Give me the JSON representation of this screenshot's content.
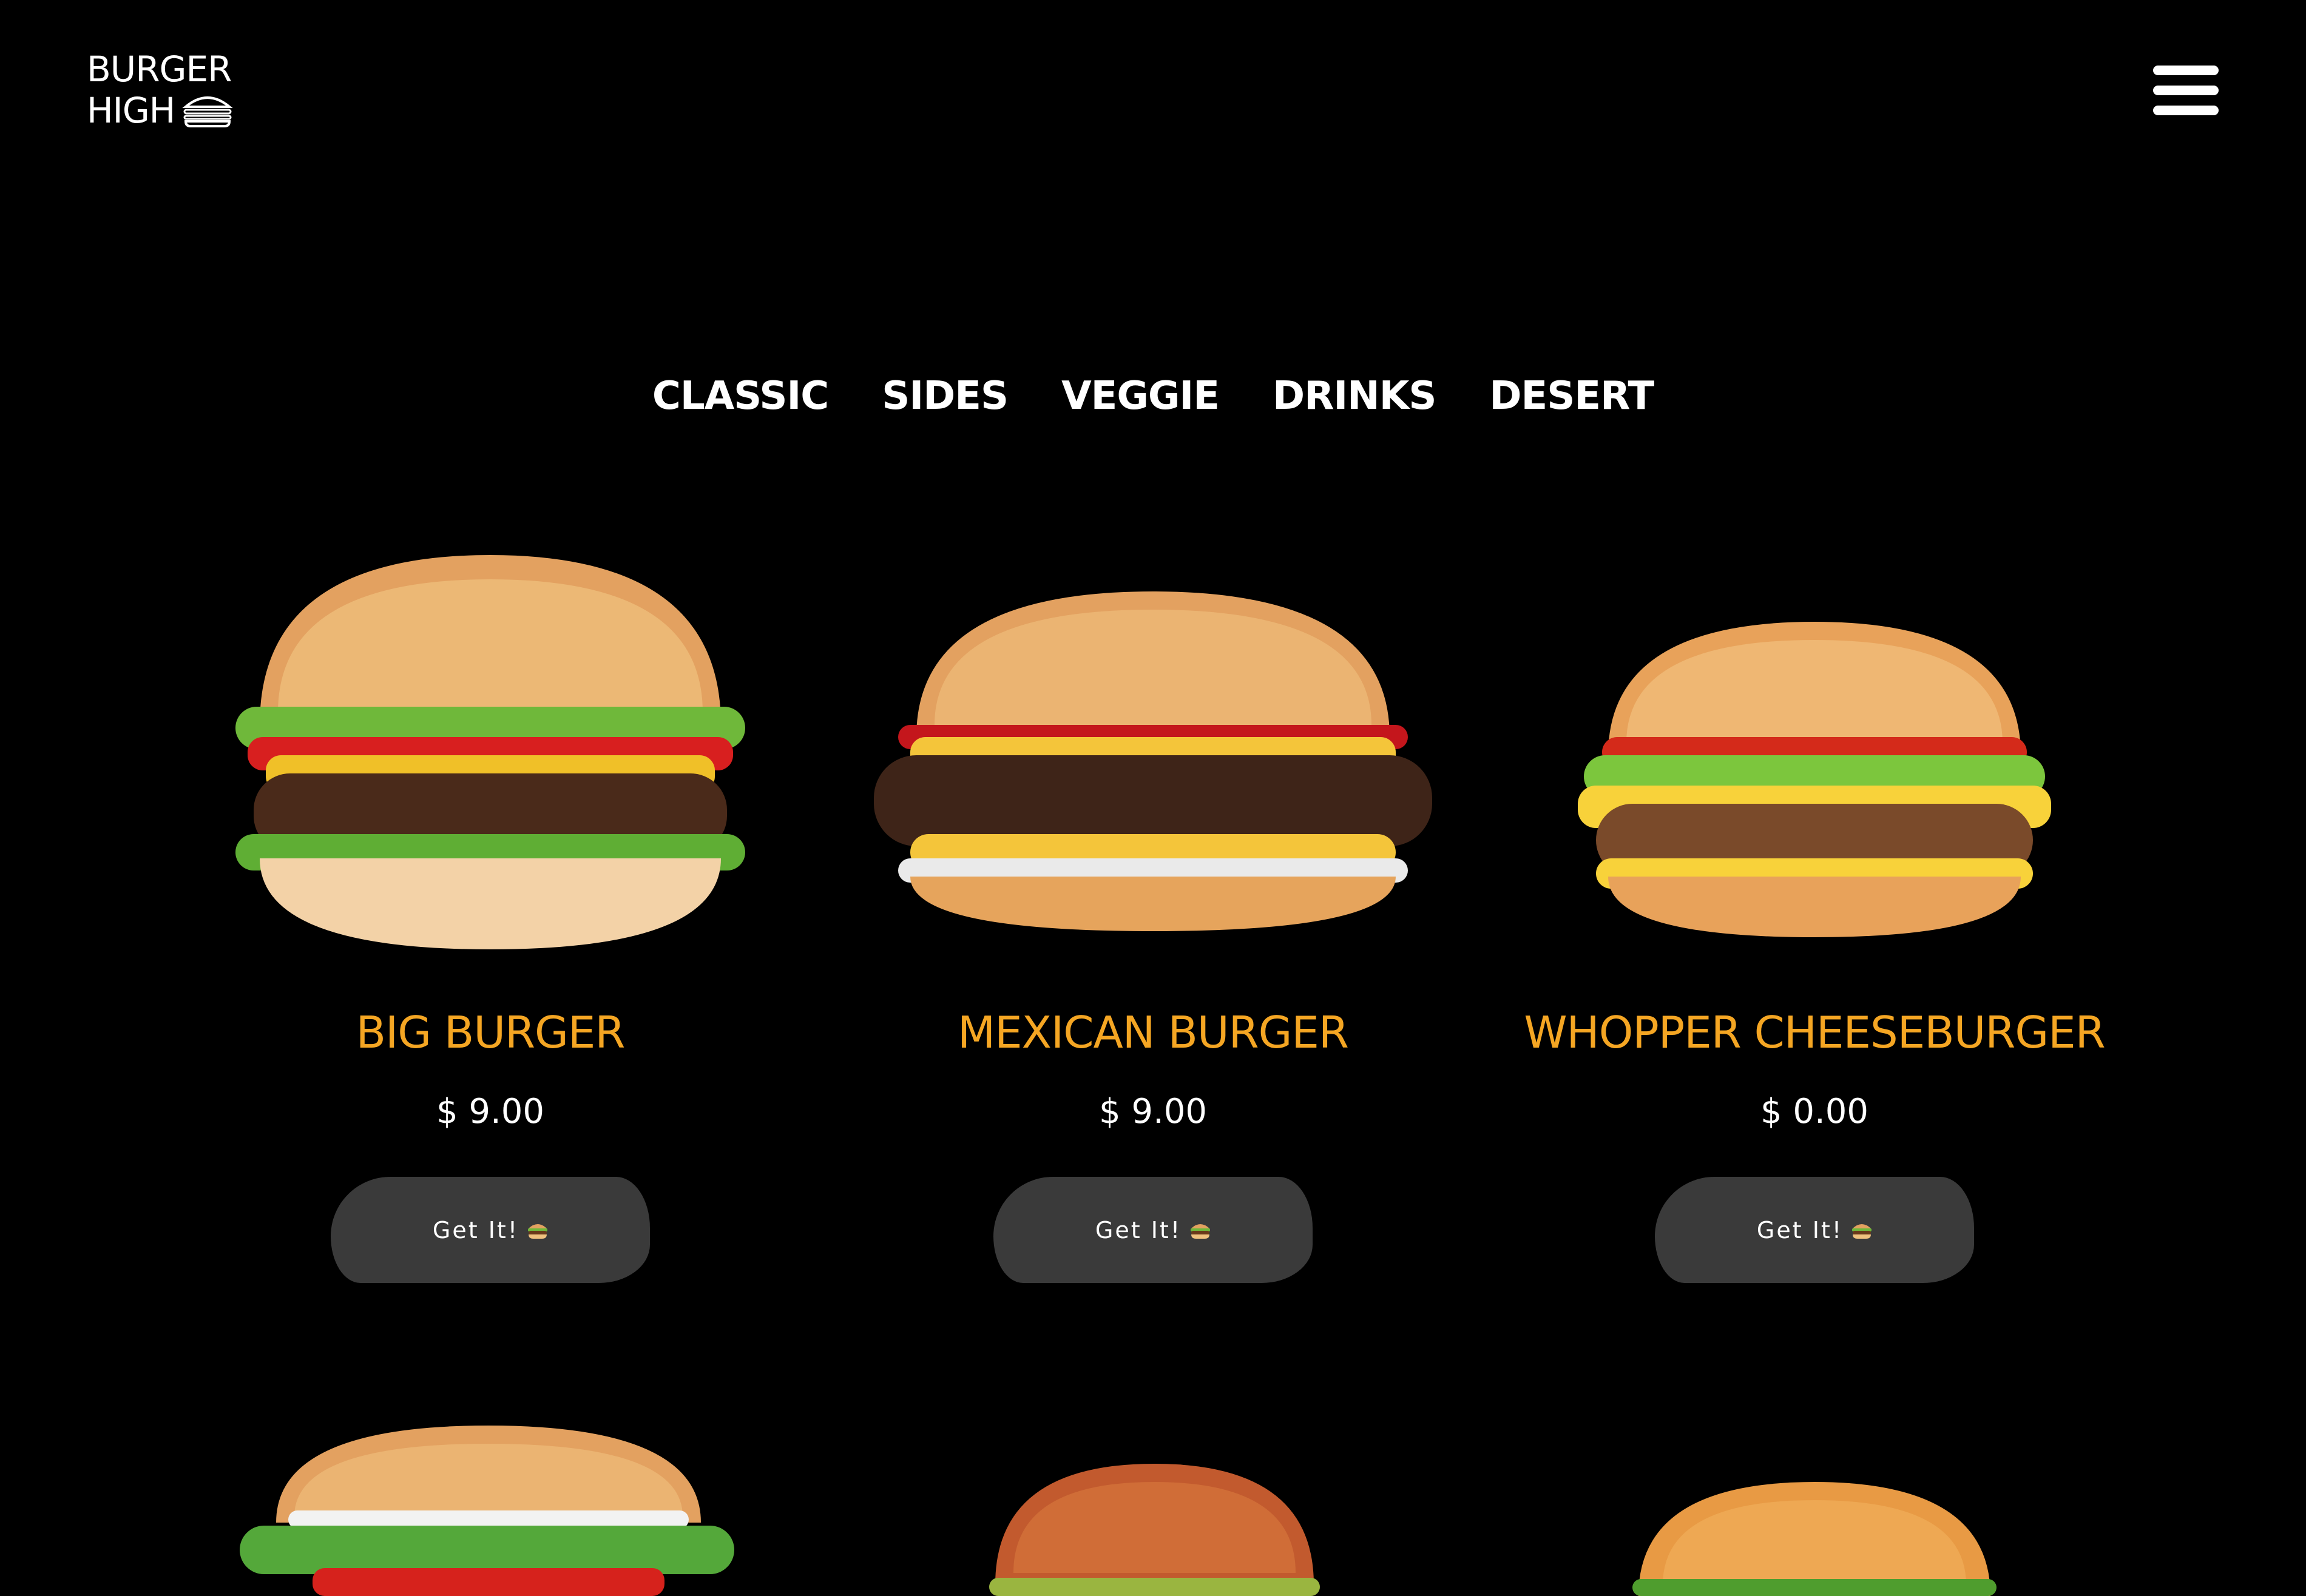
{
  "header": {
    "logo_line1": "BURGER",
    "logo_line2": "HIGH",
    "logo_icon": "burger-icon",
    "menu_icon": "hamburger-menu-icon"
  },
  "nav": {
    "items": [
      {
        "label": "CLASSIC"
      },
      {
        "label": "SIDES"
      },
      {
        "label": "VEGGIE"
      },
      {
        "label": "DRINKS"
      },
      {
        "label": "DESERT"
      }
    ]
  },
  "menu": {
    "items": [
      {
        "name": "BIG BURGER",
        "price": "$ 9.00",
        "button": "Get It!"
      },
      {
        "name": "MEXICAN BURGER",
        "price": "$ 9.00",
        "button": "Get It!"
      },
      {
        "name": "WHOPPER CHEESEBURGER",
        "price": "$ 0.00",
        "button": "Get It!"
      }
    ]
  },
  "colors": {
    "background": "#000000",
    "accent": "#f5a623",
    "button_bg": "#3a3a3a",
    "text": "#ffffff"
  }
}
